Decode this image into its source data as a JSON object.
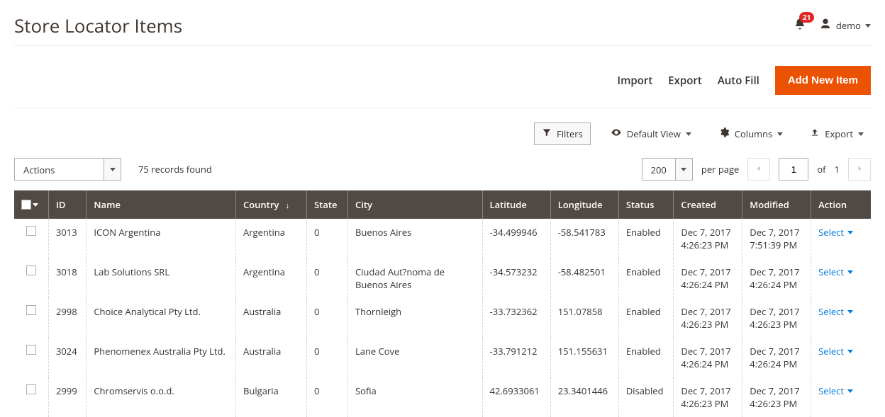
{
  "header": {
    "title": "Store Locator Items",
    "notif_count": "21",
    "user_label": "demo"
  },
  "action_bar": {
    "import": "Import",
    "export": "Export",
    "auto_fill": "Auto Fill",
    "add_new": "Add New Item"
  },
  "grid_controls": {
    "filters": "Filters",
    "default_view": "Default View",
    "columns": "Columns",
    "export": "Export"
  },
  "secondary": {
    "actions_label": "Actions",
    "records_found": "75 records found",
    "page_size": "200",
    "per_page_label": "per page",
    "current_page": "1",
    "of_label": "of",
    "total_pages": "1"
  },
  "columns": {
    "id": "ID",
    "name": "Name",
    "country": "Country",
    "state": "State",
    "city": "City",
    "latitude": "Latitude",
    "longitude": "Longitude",
    "status": "Status",
    "created": "Created",
    "modified": "Modified",
    "action": "Action"
  },
  "action_cell_label": "Select",
  "rows": [
    {
      "id": "3013",
      "name": "ICON Argentina",
      "country": "Argentina",
      "state": "0",
      "city": "Buenos Aires",
      "lat": "-34.499946",
      "lng": "-58.541783",
      "status": "Enabled",
      "created": "Dec 7, 2017 4:26:23 PM",
      "modified": "Dec 7, 2017 7:51:39 PM"
    },
    {
      "id": "3018",
      "name": "Lab Solutions SRL",
      "country": "Argentina",
      "state": "0",
      "city": "Ciudad Aut?noma de Buenos Aires",
      "lat": "-34.573232",
      "lng": "-58.482501",
      "status": "Enabled",
      "created": "Dec 7, 2017 4:26:24 PM",
      "modified": "Dec 7, 2017 4:26:24 PM"
    },
    {
      "id": "2998",
      "name": "Choice Analytical Pty Ltd.",
      "country": "Australia",
      "state": "0",
      "city": "Thornleigh",
      "lat": "-33.732362",
      "lng": "151.07858",
      "status": "Enabled",
      "created": "Dec 7, 2017 4:26:23 PM",
      "modified": "Dec 7, 2017 4:26:23 PM"
    },
    {
      "id": "3024",
      "name": "Phenomenex Australia Pty Ltd.",
      "country": "Australia",
      "state": "0",
      "city": "Lane Cove",
      "lat": "-33.791212",
      "lng": "151.155631",
      "status": "Enabled",
      "created": "Dec 7, 2017 4:26:24 PM",
      "modified": "Dec 7, 2017 4:26:24 PM"
    },
    {
      "id": "2999",
      "name": "Chromservis o.o.d.",
      "country": "Bulgaria",
      "state": "0",
      "city": "Sofia",
      "lat": "42.6933061",
      "lng": "23.3401446",
      "status": "Disabled",
      "created": "Dec 7, 2017 4:26:23 PM",
      "modified": "Dec 7, 2017 4:26:23 PM"
    }
  ]
}
